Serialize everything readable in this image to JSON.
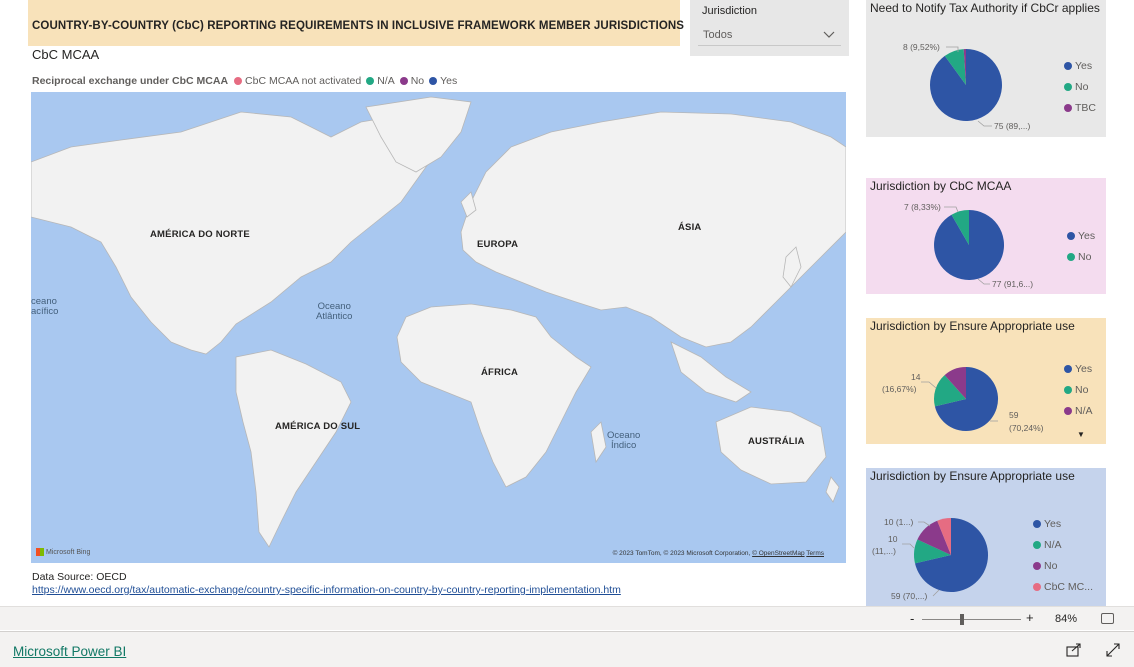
{
  "report": {
    "title": "COUNTRY-BY-COUNTRY (CbC) REPORTING REQUIREMENTS IN INCLUSIVE FRAMEWORK MEMBER JURISDICTIONS",
    "subtitle": "CbC MCAA"
  },
  "slicer": {
    "label": "Jurisdiction",
    "value": "Todos",
    "icon": "chevron-down-icon"
  },
  "map": {
    "legend_title": "Reciprocal exchange under CbC MCAA",
    "legend_items": [
      {
        "label": "CbC MCAA not activated",
        "color": "#e66c82"
      },
      {
        "label": "N/A",
        "color": "#22a884"
      },
      {
        "label": "No",
        "color": "#8b3a8b"
      },
      {
        "label": "Yes",
        "color": "#2e55a5"
      }
    ],
    "continents": {
      "north_america": "AMÉRICA DO NORTE",
      "europe": "EUROPA",
      "asia": "ÁSIA",
      "africa": "ÁFRICA",
      "south_america": "AMÉRICA DO SUL",
      "australia": "AUSTRÁLIA"
    },
    "oceans": {
      "pacific": "ceano\nacífico",
      "atlantic": "Oceano\nAtlântico",
      "indian": "Oceano\nÍndico"
    },
    "bing": "Microsoft Bing",
    "attribution_text": "© 2023 TomTom, © 2023 Microsoft Corporation, ",
    "attribution_osm": "© OpenStreetMap",
    "attribution_sep": "  ",
    "attribution_terms": "Terms",
    "colors": {
      "water": "#a9c8f0",
      "land": "#f2f2f2",
      "border": "#b7b7b7"
    }
  },
  "source": {
    "label": "Data Source: OECD",
    "url": "https://www.oecd.org/tax/automatic-exchange/country-specific-information-on-country-by-country-reporting-implementation.htm"
  },
  "cards": [
    {
      "title": "Need to Notify Tax Authority if CbCr applies",
      "background": "#e8e8e8",
      "legend": [
        {
          "label": "Yes",
          "color": "#2e55a5"
        },
        {
          "label": "No",
          "color": "#22a884"
        },
        {
          "label": "TBC",
          "color": "#8b3a8b"
        }
      ],
      "annotations": [
        "8 (9,52%)",
        "75 (89,...)"
      ]
    },
    {
      "title": "Jurisdiction by CbC MCAA",
      "background": "#f4dcef",
      "legend": [
        {
          "label": "Yes",
          "color": "#2e55a5"
        },
        {
          "label": "No",
          "color": "#22a884"
        }
      ],
      "annotations": [
        "7 (8,33%)",
        "77 (91,6...)"
      ]
    },
    {
      "title": "Jurisdiction by Ensure Appropriate use",
      "background": "#f8e2ba",
      "legend": [
        {
          "label": "Yes",
          "color": "#2e55a5"
        },
        {
          "label": "No",
          "color": "#22a884"
        },
        {
          "label": "N/A",
          "color": "#8b3a8b"
        }
      ],
      "annotations": [
        "14",
        "(16,67%)",
        "59",
        "(70,24%)"
      ],
      "scroll_icon": "▼"
    },
    {
      "title": "Jurisdiction by Ensure Appropriate use",
      "background": "#c5d3ec",
      "legend": [
        {
          "label": "Yes",
          "color": "#2e55a5"
        },
        {
          "label": "N/A",
          "color": "#22a884"
        },
        {
          "label": "No",
          "color": "#8b3a8b"
        },
        {
          "label": "CbC MC...",
          "color": "#e66c82"
        }
      ],
      "annotations": [
        "10 (1...)",
        "10",
        "(11,...)",
        "59 (70,...)"
      ]
    }
  ],
  "toolbar": {
    "zoom_minus": "-",
    "zoom_plus": "+",
    "zoom_level": "84%",
    "zoom_fraction": 0.4
  },
  "footer": {
    "brand": "Microsoft Power BI",
    "share_icon": "share-icon",
    "fullscreen_icon": "fullscreen-icon"
  }
}
